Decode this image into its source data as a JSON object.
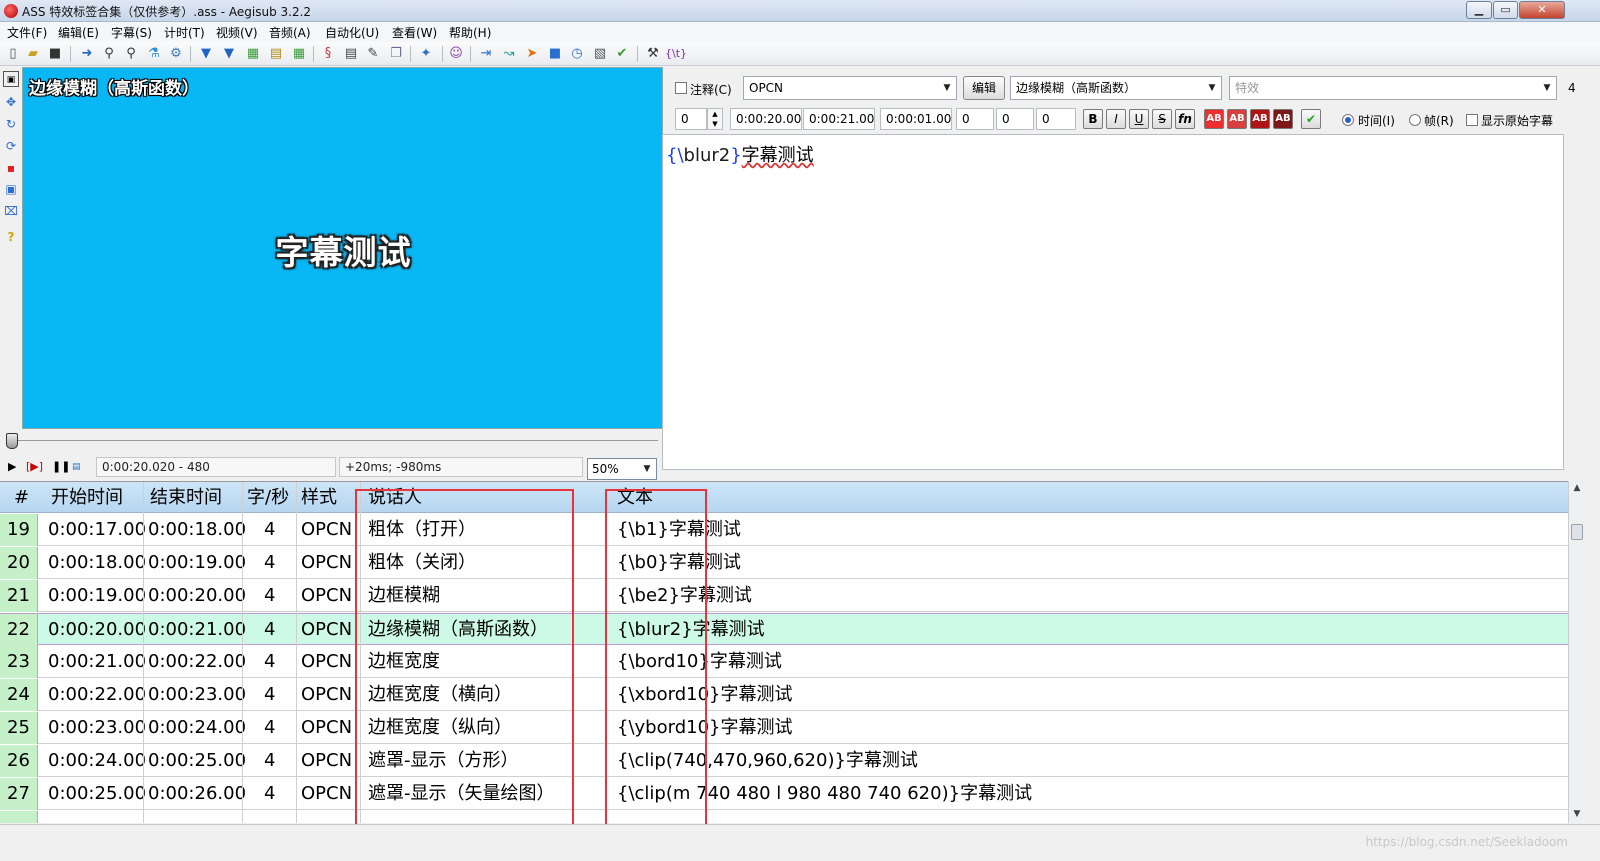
{
  "window": {
    "title": "ASS 特效标签合集（仅供参考）.ass - Aegisub 3.2.2",
    "controls": {
      "minimize": "▁",
      "maximize": "▭",
      "close": "✕"
    }
  },
  "menu": [
    "文件(F)",
    "编辑(E)",
    "字幕(S)",
    "计时(T)",
    "视频(V)",
    "音频(A)",
    "自动化(U)",
    "查看(W)",
    "帮助(H)"
  ],
  "toolbar": {
    "last_label": "{\\t}"
  },
  "video": {
    "top_text": "边缘模糊（高斯函数）",
    "center_text": "字幕测试",
    "bg_color": "#09b7f4",
    "time_display": "0:00:20.020 - 480",
    "offset_display": "+20ms; -980ms",
    "zoom": "50%"
  },
  "editor": {
    "comment_label": "注释(C)",
    "style": "OPCN",
    "edit_button": "编辑",
    "actor": "边缘模糊（高斯函数）",
    "effect_placeholder": "特效",
    "char_count": "4",
    "layer": "0",
    "start": "0:00:20.00",
    "end": "0:00:21.00",
    "duration": "0:00:01.00",
    "margin_l": "0",
    "margin_r": "0",
    "margin_v": "0",
    "format_buttons": [
      "B",
      "I",
      "U",
      "S",
      "fn",
      "AB",
      "AB",
      "AB",
      "AB",
      "✔"
    ],
    "time_radio": "时间(I)",
    "frame_radio": "帧(R)",
    "show_original": "显示原始字幕",
    "text_brace_open": "{\\",
    "text_tag": "blur2",
    "text_brace_close": "}",
    "text_body": "字幕测试"
  },
  "grid": {
    "headers": [
      "#",
      "开始时间",
      "结束时间",
      "字/秒",
      "样式",
      "说话人",
      "文本"
    ],
    "rows": [
      {
        "num": "19",
        "start": "0:00:17.00",
        "end": "0:00:18.00",
        "cps": "4",
        "style": "OPCN",
        "actor": "粗体（打开）",
        "text": "{\\b1}字幕测试"
      },
      {
        "num": "20",
        "start": "0:00:18.00",
        "end": "0:00:19.00",
        "cps": "4",
        "style": "OPCN",
        "actor": "粗体（关闭）",
        "text": "{\\b0}字幕测试"
      },
      {
        "num": "21",
        "start": "0:00:19.00",
        "end": "0:00:20.00",
        "cps": "4",
        "style": "OPCN",
        "actor": "边框模糊",
        "text": "{\\be2}字幕测试"
      },
      {
        "num": "22",
        "start": "0:00:20.00",
        "end": "0:00:21.00",
        "cps": "4",
        "style": "OPCN",
        "actor": "边缘模糊（高斯函数）",
        "text": "{\\blur2}字幕测试",
        "selected": true
      },
      {
        "num": "23",
        "start": "0:00:21.00",
        "end": "0:00:22.00",
        "cps": "4",
        "style": "OPCN",
        "actor": "边框宽度",
        "text": "{\\bord10}字幕测试"
      },
      {
        "num": "24",
        "start": "0:00:22.00",
        "end": "0:00:23.00",
        "cps": "4",
        "style": "OPCN",
        "actor": "边框宽度（横向）",
        "text": "{\\xbord10}字幕测试"
      },
      {
        "num": "25",
        "start": "0:00:23.00",
        "end": "0:00:24.00",
        "cps": "4",
        "style": "OPCN",
        "actor": "边框宽度（纵向）",
        "text": "{\\ybord10}字幕测试"
      },
      {
        "num": "26",
        "start": "0:00:24.00",
        "end": "0:00:25.00",
        "cps": "4",
        "style": "OPCN",
        "actor": "遮罩-显示（方形）",
        "text": "{\\clip(740,470,960,620)}字幕测试"
      },
      {
        "num": "27",
        "start": "0:00:25.00",
        "end": "0:00:26.00",
        "cps": "4",
        "style": "OPCN",
        "actor": "遮罩-显示（矢量绘图）",
        "text": "{\\clip(m 740 480 l 980 480 740 620)}字幕测试"
      }
    ]
  },
  "status": {
    "watermark": "https://blog.csdn.net/Seekladoom"
  },
  "colors": {
    "highlight_box": "#e8343b",
    "selected_row": "#cdf9e8",
    "row_number_bg": "#c6f0c8",
    "header_bg": "#b6d6f0"
  }
}
